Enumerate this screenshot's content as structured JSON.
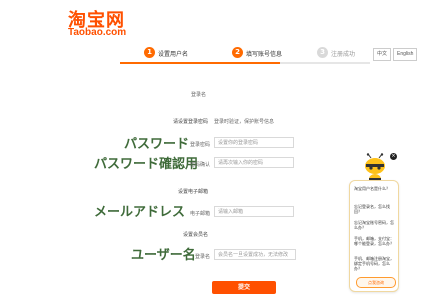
{
  "header": {
    "logo_cn": "淘宝网",
    "logo_en": "Taobao.com",
    "lang_cn": "中文",
    "lang_en": "English"
  },
  "steps": [
    {
      "num": "1",
      "label": "设置用户名"
    },
    {
      "num": "2",
      "label": "填写账号信息"
    },
    {
      "num": "3",
      "label": "注册成功"
    }
  ],
  "form": {
    "login_name_label": "登录名",
    "login_password_section": "请设置登录密码",
    "login_password_hint": "登录时验证，保护账号信息",
    "password_label": "登录密码",
    "password_placeholder": "设置你的登录密码",
    "confirm_label": "密码确认",
    "confirm_placeholder": "请再次输入你的密码",
    "email_section": "设置电子邮箱",
    "email_label": "电子邮箱",
    "email_placeholder": "请输入邮箱",
    "nickname_section": "设置会员名",
    "nickname_label": "登录名",
    "nickname_placeholder": "会员名一旦设置成功，无法修改",
    "submit_label": "提交"
  },
  "annotations": {
    "password": "パスワード",
    "password_confirm": "パスワード確認用",
    "email": "メールアドレス",
    "username": "ユーザー名"
  },
  "assistant": {
    "items": [
      "淘宝用户名是什么？",
      "忘记登录名，怎么找回？",
      "忘记淘宝账号密码，怎么办？",
      "手机，邮箱，支付宝：哪个能登录，怎么办？",
      "手机、邮箱注册淘宝，绑定手机号码，怎么办？"
    ],
    "button_label": "点我咨询"
  }
}
